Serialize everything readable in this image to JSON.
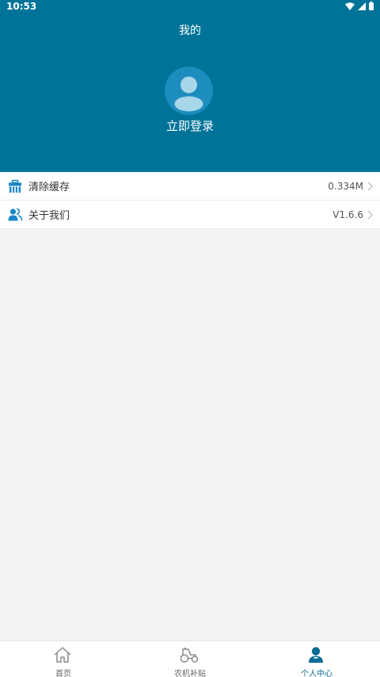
{
  "status_bar": {
    "time": "10:53"
  },
  "header": {
    "title": "我的",
    "login_label": "立即登录"
  },
  "menu": {
    "items": [
      {
        "label": "清除缓存",
        "value": "0.334M",
        "icon": "toolbox-icon"
      },
      {
        "label": "关于我们",
        "value": "V1.6.6",
        "icon": "users-icon"
      }
    ]
  },
  "tabbar": {
    "tabs": [
      {
        "label": "首页",
        "icon": "home-icon",
        "active": false
      },
      {
        "label": "农机补贴",
        "icon": "tractor-icon",
        "active": false
      },
      {
        "label": "个人中心",
        "icon": "user-icon",
        "active": true
      }
    ]
  },
  "colors": {
    "header_bg": "#007399",
    "avatar_bg": "#1d8dbe",
    "active_tab": "#0a6d95",
    "background": "#f2f2f2"
  }
}
